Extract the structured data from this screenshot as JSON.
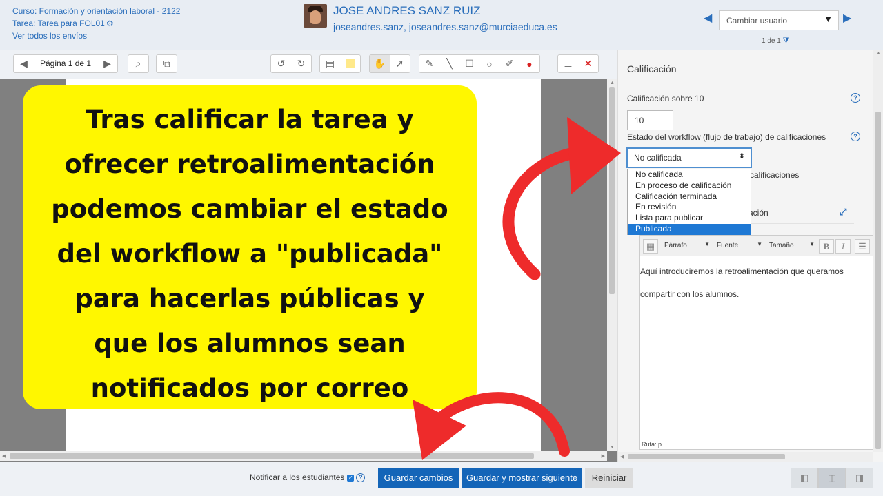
{
  "header": {
    "course": "Curso: Formación y orientación laboral - 2122",
    "task": "Tarea: Tarea para FOL01",
    "view_all": "Ver todos los envíos",
    "user_name": "JOSE ANDRES SANZ RUIZ",
    "user_email": "joseandres.sanz, joseandres.sanz@murciaeduca.es",
    "change_user": "Cambiar usuario",
    "user_count": "1 de 1"
  },
  "toolbar": {
    "page_label": "Página 1 de 1"
  },
  "panel": {
    "title": "Calificación",
    "grade_label": "Calificación sobre 10",
    "grade_value": "10",
    "workflow_label": "Estado del workflow (flujo de trabajo) de calificaciones",
    "workflow_selected": "No calificada",
    "workflow_options": [
      "No calificada",
      "En proceso de calificación",
      "Calificación terminada",
      "En revisión",
      "Lista para publicar",
      "Publicada"
    ],
    "behind_text_1": "calificaciones",
    "behind_text_2": "ación",
    "editor": {
      "format": "Párrafo",
      "font": "Fuente",
      "size": "Tamaño",
      "bold": "B",
      "italic": "I",
      "line1": "Aquí introduciremos la retroalimentación que queramos",
      "line2": "compartir con los alumnos.",
      "path": "Ruta: p"
    }
  },
  "footer": {
    "notify": "Notificar a los estudiantes",
    "save": "Guardar cambios",
    "save_next": "Guardar y mostrar siguiente",
    "reset": "Reiniciar"
  },
  "annotation": {
    "line1": "Tras calificar la tarea y",
    "line2": "ofrecer retroalimentación",
    "line3": "podemos cambiar el estado",
    "line4": "del workflow a \"publicada\"",
    "line5": "para hacerlas públicas y",
    "line6": "que los alumnos sean",
    "line7": "notificados por correo"
  },
  "colors": {
    "link_blue": "#2a6ebb",
    "primary_button": "#1465b8",
    "callout_yellow": "#fff700",
    "arrow_red": "#ee2b2b"
  }
}
